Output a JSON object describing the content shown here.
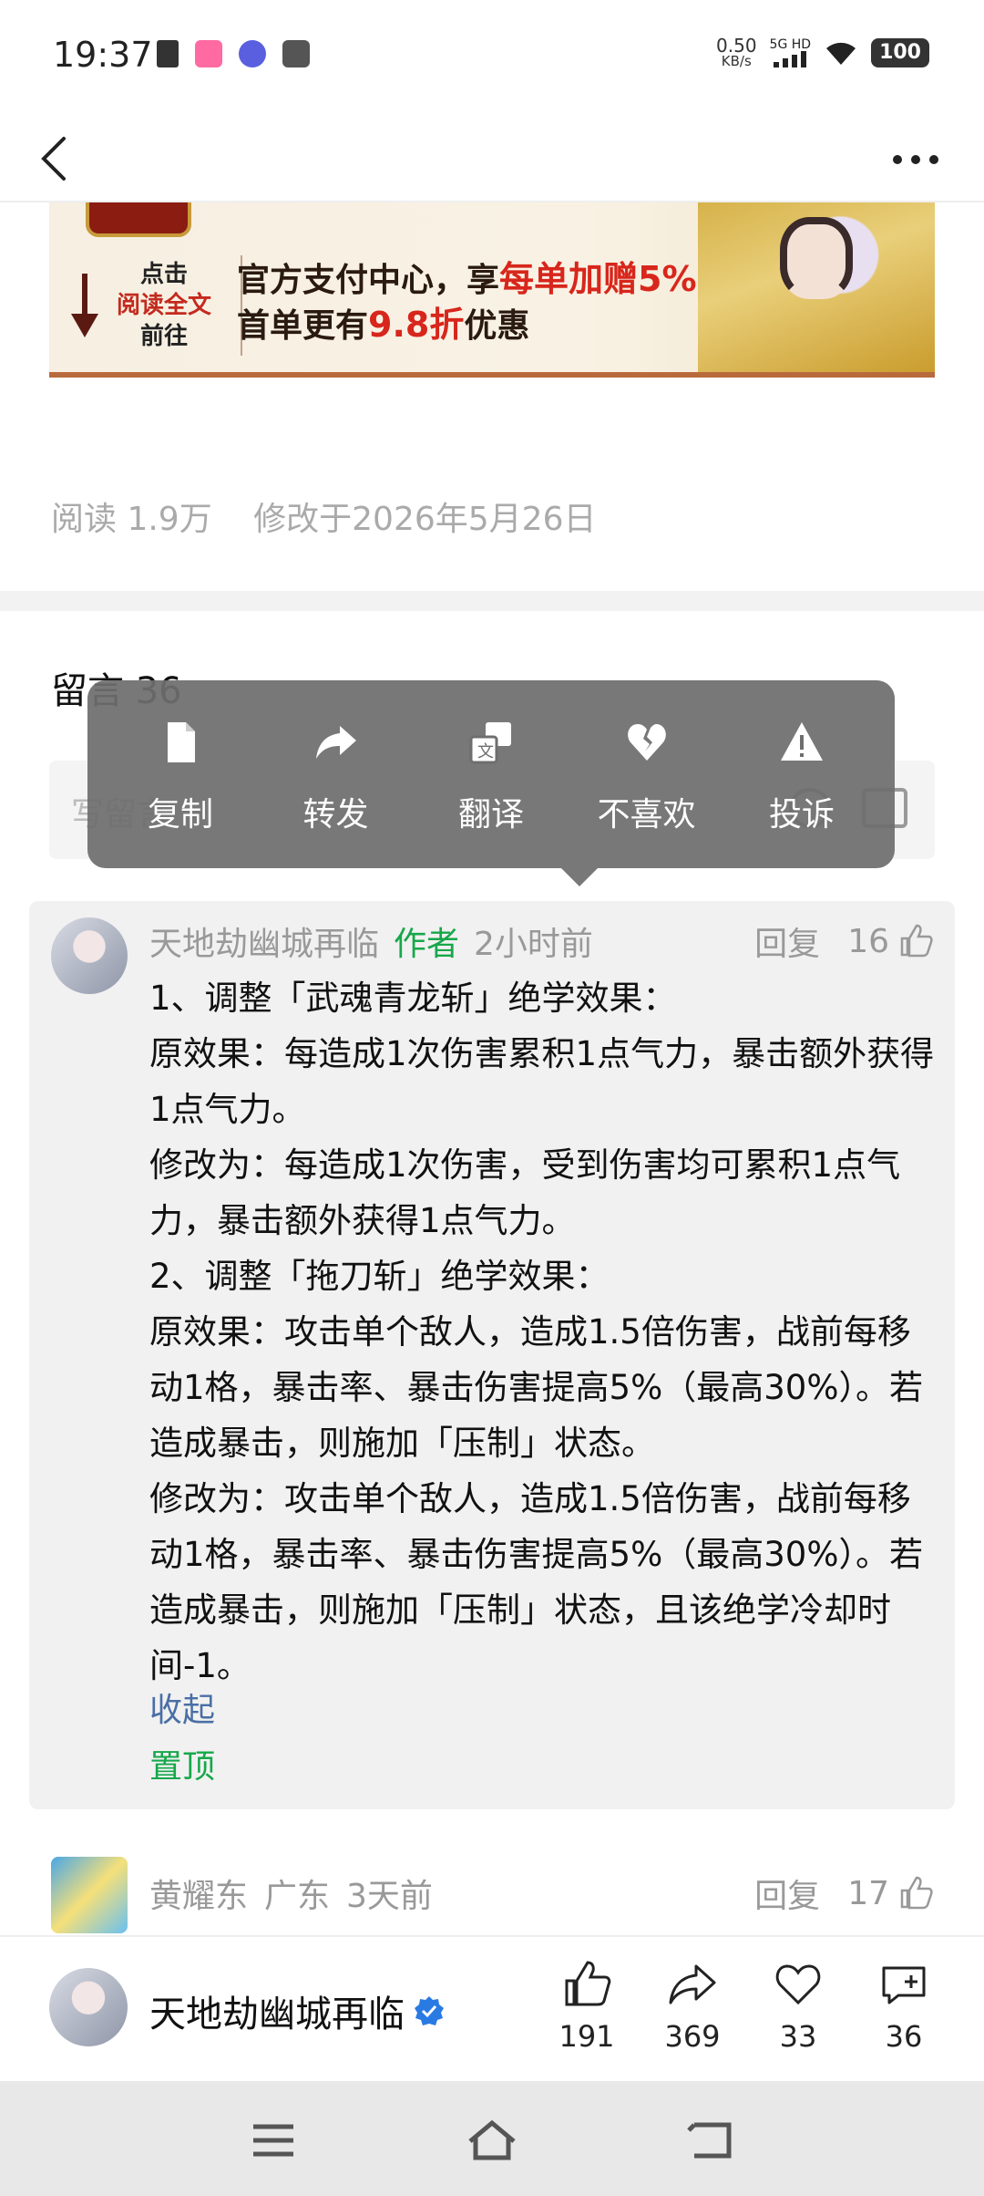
{
  "status_bar": {
    "time": "19:37",
    "net_speed_value": "0.50",
    "net_speed_unit": "KB/s",
    "signal_label": "5G HD",
    "battery": "100"
  },
  "banner": {
    "left_line1": "点击",
    "left_line2": "阅读全文",
    "left_line3": "前往",
    "main_line1_prefix": "官方支付中心，享",
    "main_line1_highlight": "每单加赠5%",
    "main_line2_prefix": "首单更有",
    "main_line2_highlight": "9.8折",
    "main_line2_suffix": "优惠"
  },
  "meta": {
    "reads": "阅读 1.9万",
    "modified": "修改于2026年5月26日"
  },
  "comments": {
    "title": "留言 36",
    "input_placeholder": "写留言"
  },
  "context_menu": {
    "items": [
      {
        "label": "复制",
        "icon": "copy-icon"
      },
      {
        "label": "转发",
        "icon": "forward-icon"
      },
      {
        "label": "翻译",
        "icon": "translate-icon"
      },
      {
        "label": "不喜欢",
        "icon": "broken-heart-icon"
      },
      {
        "label": "投诉",
        "icon": "warning-icon"
      }
    ]
  },
  "comment1": {
    "author": "天地劫幽城再临",
    "tag": "作者",
    "time": "2小时前",
    "reply": "回复",
    "likes": "16",
    "lines": [
      "1、调整「武魂青龙斩」绝学效果：",
      "原效果：每造成1次伤害累积1点气力，暴击额外获得1点气力。",
      "修改为：每造成1次伤害，受到伤害均可累积1点气力，暴击额外获得1点气力。",
      "2、调整「拖刀斩」绝学效果：",
      "原效果：攻击单个敌人，造成1.5倍伤害，战前每移动1格，暴击率、暴击伤害提高5%（最高30%）。若造成暴击，则施加「压制」状态。",
      "修改为：攻击单个敌人，造成1.5倍伤害，战前每移动1格，暴击率、暴击伤害提高5%（最高30%）。若造成暴击，则施加「压制」状态，且该绝学冷却时间-1。"
    ],
    "collapse": "收起",
    "pinned": "置顶"
  },
  "comment2": {
    "author": "黄耀东",
    "location": "广东",
    "time": "3天前",
    "reply": "回复",
    "likes": "17"
  },
  "bottom_bar": {
    "author": "天地劫幽城再临",
    "likes": "191",
    "shares": "369",
    "favorites": "33",
    "comments": "36"
  }
}
